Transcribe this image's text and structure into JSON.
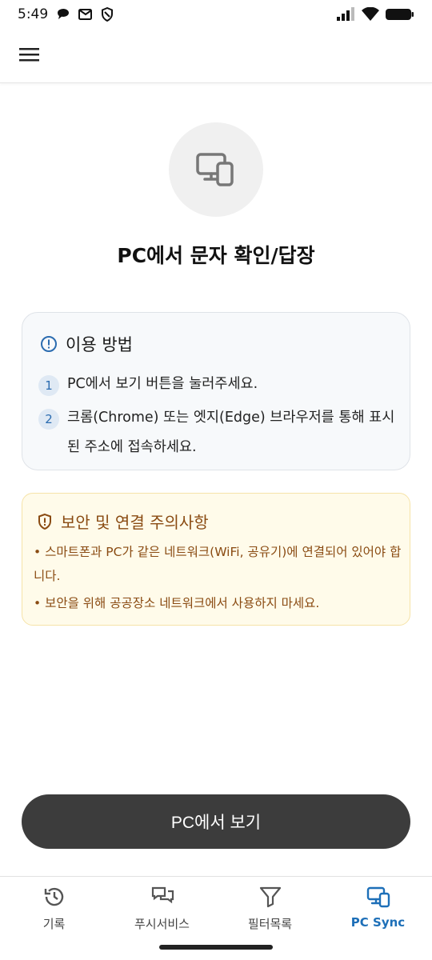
{
  "status_bar": {
    "time": "5:49",
    "left_icons": [
      "chat-bubble-icon",
      "mail-icon",
      "shield-icon"
    ],
    "right_icons": [
      "signal-icon",
      "wifi-icon",
      "battery-icon"
    ]
  },
  "app_bar": {
    "menu_icon": "hamburger-menu-icon"
  },
  "hero": {
    "icon": "pc-mobile-sync-icon"
  },
  "page_title": "PC에서 문자 확인/답장",
  "howto": {
    "icon": "info-circle-icon",
    "title": "이용 방법",
    "steps": [
      {
        "num": "1",
        "text": "PC에서 보기 버튼을 눌러주세요."
      },
      {
        "num": "2",
        "text": "크롬(Chrome) 또는 엣지(Edge) 브라우저를 통해 표시된 주소에 접속하세요."
      }
    ]
  },
  "warning": {
    "icon": "shield-icon",
    "title": "보안 및 연결 주의사항",
    "items": [
      "• 스마트폰과 PC가 같은 네트워크(WiFi, 공유기)에 연결되어 있어야 합니다.",
      "• 보안을 위해 공공장소 네트워크에서 사용하지 마세요."
    ],
    "color": "#8a4b12"
  },
  "primary_button": {
    "label": "PC에서 보기"
  },
  "bottom_nav": {
    "items": [
      {
        "label": "기록",
        "icon": "history-icon",
        "active": false
      },
      {
        "label": "푸시서비스",
        "icon": "chat-icon",
        "active": false
      },
      {
        "label": "필터목록",
        "icon": "filter-icon",
        "active": false
      },
      {
        "label": "PC Sync",
        "icon": "pc-sync-icon",
        "active": true
      }
    ],
    "active_color": "#1d6fb8"
  }
}
